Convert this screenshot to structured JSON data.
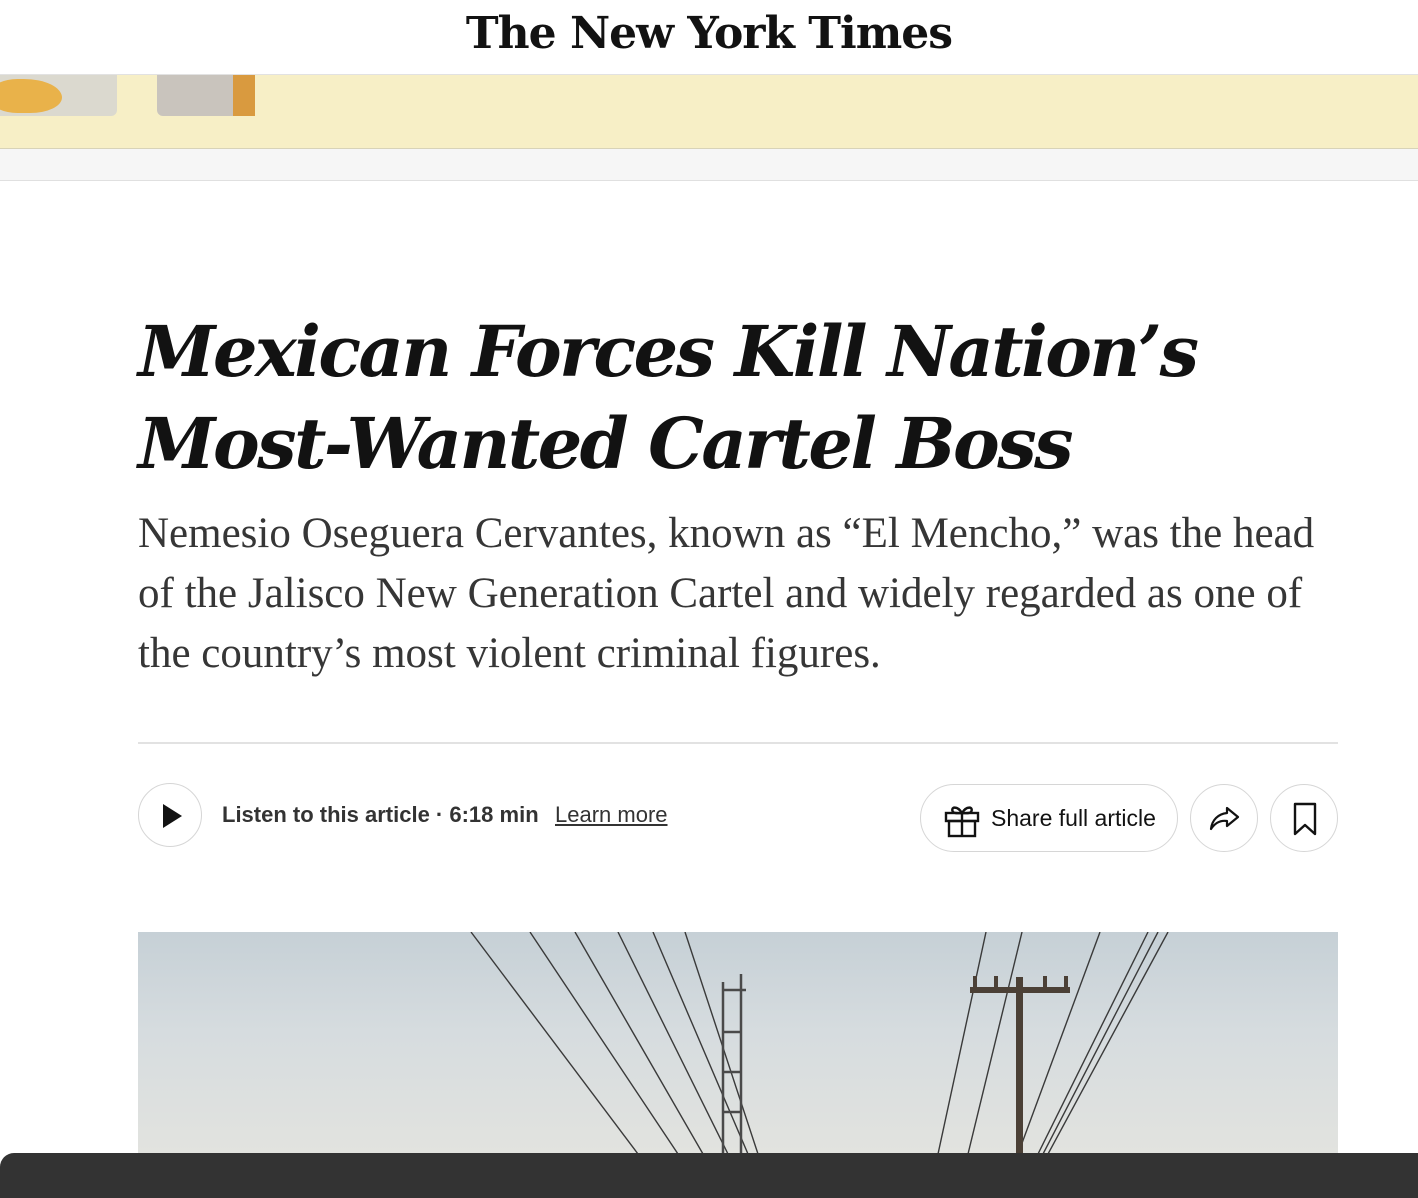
{
  "masthead": {
    "logo_text": "The New York Times"
  },
  "article": {
    "headline": "Mexican Forces Kill Nation’s Most-Wanted Cartel Boss",
    "summary": "Nemesio Oseguera Cervantes, known as “El Mencho,” was the head of the Jalisco New Generation Cartel and widely regarded as one of the country’s most violent criminal figures."
  },
  "tools": {
    "listen_label": "Listen to this article · 6:18 min",
    "learn_more": "Learn more",
    "share_full_label": "Share full article"
  },
  "icons": {
    "play": "play-icon",
    "gift": "gift-icon",
    "share": "share-arrow-icon",
    "bookmark": "bookmark-icon"
  },
  "colors": {
    "ad_background": "#f7efc6",
    "text_primary": "#121212",
    "text_secondary": "#363636",
    "bottom_bar": "#333333"
  }
}
